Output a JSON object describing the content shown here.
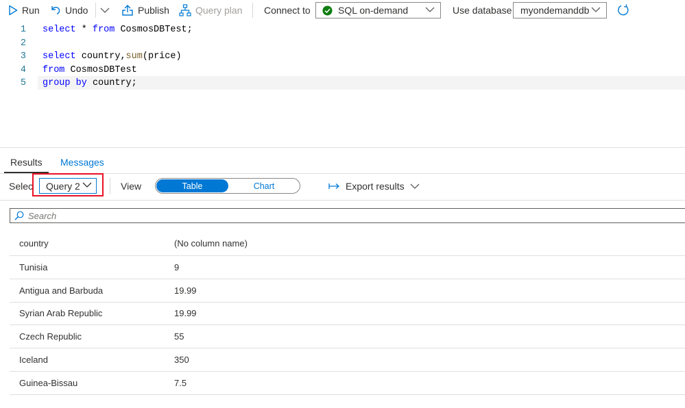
{
  "toolbar": {
    "run_label": "Run",
    "undo_label": "Undo",
    "publish_label": "Publish",
    "query_plan_label": "Query plan",
    "connect_to_label": "Connect to",
    "connection_value": "SQL on-demand",
    "use_database_label": "Use database",
    "database_value": "myondemanddb",
    "status_color": "#107c10",
    "accent_color": "#0078d4"
  },
  "editor": {
    "lines": [
      {
        "number": "1",
        "text": "select * from CosmosDBTest;"
      },
      {
        "number": "2",
        "text": ""
      },
      {
        "number": "3",
        "text": "select country,sum(price)"
      },
      {
        "number": "4",
        "text": "from CosmosDBTest"
      },
      {
        "number": "5",
        "text": "group by country;"
      }
    ]
  },
  "results": {
    "tabs": [
      {
        "label": "Results",
        "active": true
      },
      {
        "label": "Messages",
        "active": false
      }
    ],
    "select_label": "Select",
    "query_value": "Query 2",
    "view_label": "View",
    "view_options": [
      "Table",
      "Chart"
    ],
    "view_selected": "Table",
    "export_label": "Export results",
    "search_placeholder": "Search",
    "columns": [
      "country",
      "(No column name)"
    ],
    "rows": [
      [
        "Tunisia",
        "9"
      ],
      [
        "Antigua and Barbuda",
        "19.99"
      ],
      [
        "Syrian Arab Republic",
        "19.99"
      ],
      [
        "Czech Republic",
        "55"
      ],
      [
        "Iceland",
        "350"
      ],
      [
        "Guinea-Bissau",
        "7.5"
      ]
    ]
  }
}
